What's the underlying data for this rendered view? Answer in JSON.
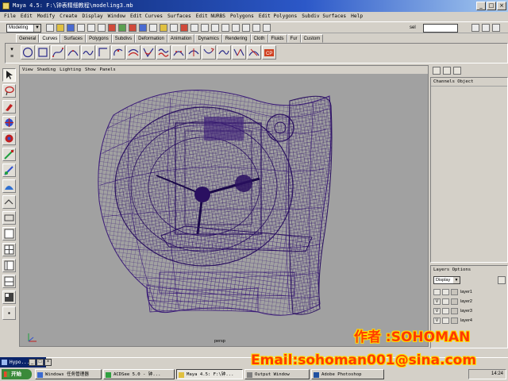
{
  "window": {
    "title": "Maya 4.5: F:\\钟表精细教程\\modeling3.mb",
    "min": "_",
    "max": "□",
    "close": "×"
  },
  "menubar": [
    "File",
    "Edit",
    "Modify",
    "Create",
    "Display",
    "Window",
    "Edit Curves",
    "Surfaces",
    "Edit NURBS",
    "Polygons",
    "Edit Polygons",
    "Subdiv Surfaces",
    "Help"
  ],
  "status_line": {
    "mode": "Modeling",
    "sel_label": "sel"
  },
  "shelf": {
    "tabs": [
      "General",
      "Curves",
      "Surfaces",
      "Polygons",
      "Subdivs",
      "Deformation",
      "Animation",
      "Dynamics",
      "Rendering",
      "Cloth",
      "Fluids",
      "Fur",
      "Custom"
    ],
    "active_tab": "Curves",
    "icons": [
      "circle-icon",
      "square-icon",
      "cv-curve-icon",
      "ep-curve-icon",
      "pencil-curve-icon",
      "arc-icon",
      "arc2-icon",
      "offset-icon",
      "fillet-icon",
      "blend-icon",
      "rebuild-icon",
      "insert-knot-icon",
      "reverse-icon",
      "cut-icon",
      "attach-icon",
      "detach-icon",
      "cp-icon"
    ]
  },
  "viewport": {
    "menu": [
      "View",
      "Shading",
      "Lighting",
      "Show",
      "Panels"
    ],
    "camera_label": "persp"
  },
  "channel_box": {
    "title": "Channels  Object"
  },
  "layers": {
    "menu": "Layers  Options",
    "display": "Display",
    "rows": [
      {
        "name": "layer1",
        "visible": ""
      },
      {
        "name": "layer2",
        "visible": "V"
      },
      {
        "name": "layer3",
        "visible": "V"
      },
      {
        "name": "layer4",
        "visible": "V"
      }
    ]
  },
  "hypo_window": {
    "title": "Hypo..."
  },
  "taskbar": {
    "start": "开始",
    "tasks": [
      {
        "label": "Windows 任务管理器",
        "active": false
      },
      {
        "label": "ACDSee 5.0 - 钟...",
        "active": false
      },
      {
        "label": "Maya 4.5: F:\\钟...",
        "active": true
      },
      {
        "label": "Output Window",
        "active": false
      },
      {
        "label": "Adobe Photoshop",
        "active": false
      }
    ],
    "clock": "14:24"
  },
  "watermark": {
    "author": "作者 :SOHOMAN",
    "email": "Email:sohoman001@sina.com"
  },
  "colors": {
    "wireframe": "#3a1a78",
    "viewport_bg": "#a1a1a1",
    "title_start": "#0a246a",
    "watermark": "#ff3b00"
  }
}
